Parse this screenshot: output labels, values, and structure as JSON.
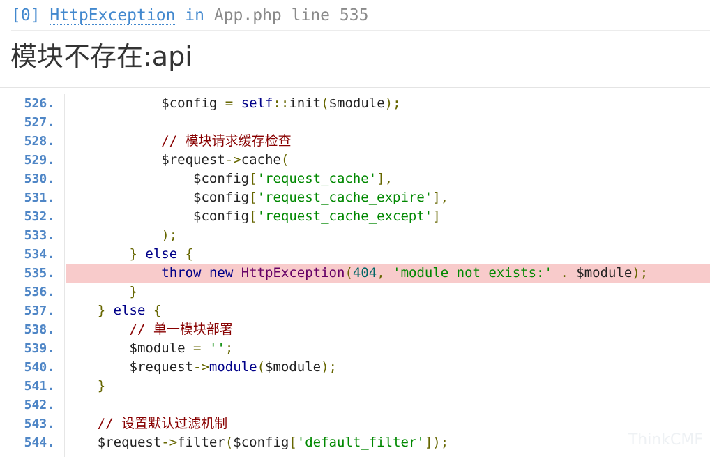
{
  "header": {
    "index": "[0]",
    "exception_class": "HttpException",
    "in_word": "in",
    "file": "App.php",
    "line_word": "line",
    "line_no": "535",
    "message": "模块不存在:api"
  },
  "code": {
    "highlight_line": "535.",
    "lines": [
      {
        "no": "526.",
        "indent": "            ",
        "tokens": [
          [
            "plain",
            "$config "
          ],
          [
            "pun",
            "="
          ],
          [
            "plain",
            " "
          ],
          [
            "fn",
            "self"
          ],
          [
            "pun",
            "::"
          ],
          [
            "plain",
            "init"
          ],
          [
            "pun",
            "("
          ],
          [
            "plain",
            "$module"
          ],
          [
            "pun",
            ");"
          ]
        ]
      },
      {
        "no": "527.",
        "indent": "",
        "tokens": []
      },
      {
        "no": "528.",
        "indent": "            ",
        "tokens": [
          [
            "cm",
            "// 模块请求缓存检查"
          ]
        ]
      },
      {
        "no": "529.",
        "indent": "            ",
        "tokens": [
          [
            "plain",
            "$request"
          ],
          [
            "pun",
            "->"
          ],
          [
            "plain",
            "cache"
          ],
          [
            "pun",
            "("
          ]
        ]
      },
      {
        "no": "530.",
        "indent": "                ",
        "tokens": [
          [
            "plain",
            "$config"
          ],
          [
            "pun",
            "["
          ],
          [
            "str",
            "'request_cache'"
          ],
          [
            "pun",
            "],"
          ]
        ]
      },
      {
        "no": "531.",
        "indent": "                ",
        "tokens": [
          [
            "plain",
            "$config"
          ],
          [
            "pun",
            "["
          ],
          [
            "str",
            "'request_cache_expire'"
          ],
          [
            "pun",
            "],"
          ]
        ]
      },
      {
        "no": "532.",
        "indent": "                ",
        "tokens": [
          [
            "plain",
            "$config"
          ],
          [
            "pun",
            "["
          ],
          [
            "str",
            "'request_cache_except'"
          ],
          [
            "pun",
            "]"
          ]
        ]
      },
      {
        "no": "533.",
        "indent": "            ",
        "tokens": [
          [
            "pun",
            ");"
          ]
        ]
      },
      {
        "no": "534.",
        "indent": "        ",
        "tokens": [
          [
            "pun",
            "}"
          ],
          [
            "plain",
            " "
          ],
          [
            "kw",
            "else"
          ],
          [
            "plain",
            " "
          ],
          [
            "pun",
            "{"
          ]
        ]
      },
      {
        "no": "535.",
        "indent": "            ",
        "tokens": [
          [
            "kw",
            "throw"
          ],
          [
            "plain",
            " "
          ],
          [
            "kw",
            "new"
          ],
          [
            "plain",
            " "
          ],
          [
            "cls",
            "HttpException"
          ],
          [
            "pun",
            "("
          ],
          [
            "num",
            "404"
          ],
          [
            "pun",
            ","
          ],
          [
            "plain",
            " "
          ],
          [
            "str",
            "'module not exists:'"
          ],
          [
            "plain",
            " "
          ],
          [
            "pun",
            "."
          ],
          [
            "plain",
            " $module"
          ],
          [
            "pun",
            ");"
          ]
        ]
      },
      {
        "no": "536.",
        "indent": "        ",
        "tokens": [
          [
            "pun",
            "}"
          ]
        ]
      },
      {
        "no": "537.",
        "indent": "    ",
        "tokens": [
          [
            "pun",
            "}"
          ],
          [
            "plain",
            " "
          ],
          [
            "kw",
            "else"
          ],
          [
            "plain",
            " "
          ],
          [
            "pun",
            "{"
          ]
        ]
      },
      {
        "no": "538.",
        "indent": "        ",
        "tokens": [
          [
            "cm",
            "// 单一模块部署"
          ]
        ]
      },
      {
        "no": "539.",
        "indent": "        ",
        "tokens": [
          [
            "plain",
            "$module "
          ],
          [
            "pun",
            "="
          ],
          [
            "plain",
            " "
          ],
          [
            "str",
            "''"
          ],
          [
            "pun",
            ";"
          ]
        ]
      },
      {
        "no": "540.",
        "indent": "        ",
        "tokens": [
          [
            "plain",
            "$request"
          ],
          [
            "pun",
            "->"
          ],
          [
            "fn",
            "module"
          ],
          [
            "pun",
            "("
          ],
          [
            "plain",
            "$module"
          ],
          [
            "pun",
            ");"
          ]
        ]
      },
      {
        "no": "541.",
        "indent": "    ",
        "tokens": [
          [
            "pun",
            "}"
          ]
        ]
      },
      {
        "no": "542.",
        "indent": "",
        "tokens": []
      },
      {
        "no": "543.",
        "indent": "    ",
        "tokens": [
          [
            "cm",
            "// 设置默认过滤机制"
          ]
        ]
      },
      {
        "no": "544.",
        "indent": "    ",
        "tokens": [
          [
            "plain",
            "$request"
          ],
          [
            "pun",
            "->"
          ],
          [
            "plain",
            "filter"
          ],
          [
            "pun",
            "("
          ],
          [
            "plain",
            "$config"
          ],
          [
            "pun",
            "["
          ],
          [
            "str",
            "'default_filter'"
          ],
          [
            "pun",
            "]);"
          ]
        ]
      }
    ]
  },
  "watermark": "ThinkCMF"
}
